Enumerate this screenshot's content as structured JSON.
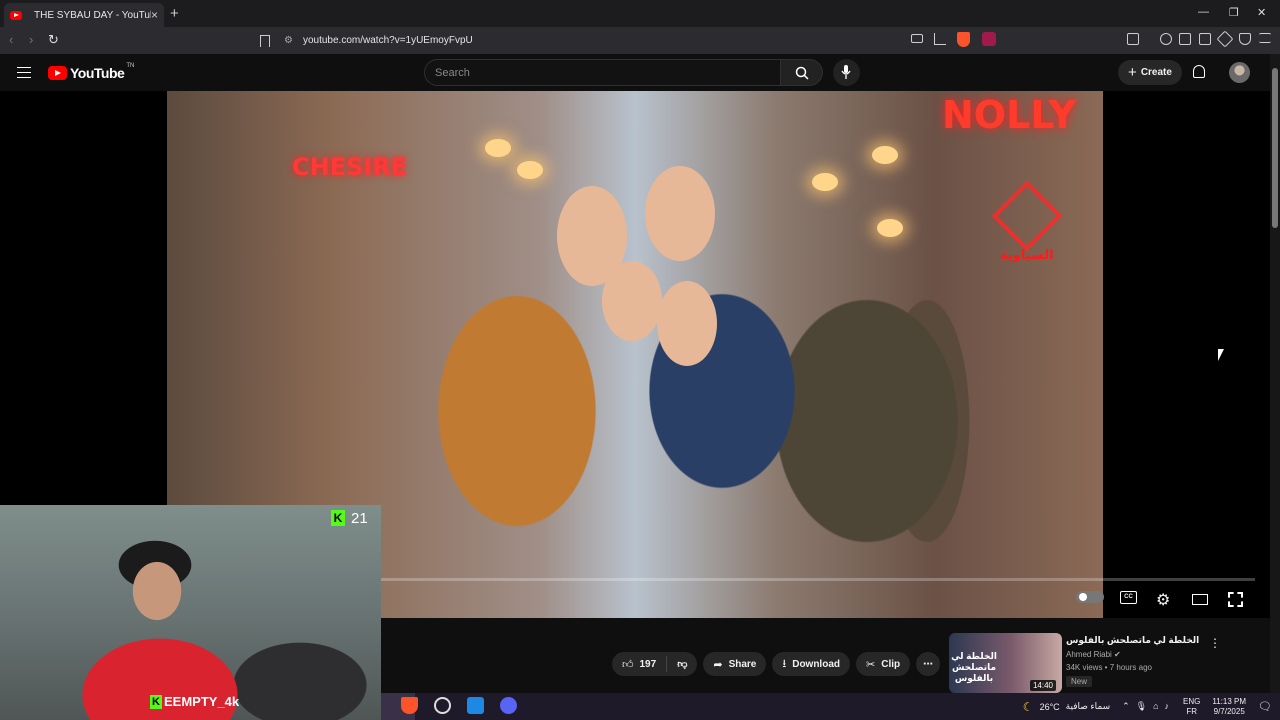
{
  "browser": {
    "tab_title": "THE SYBAU DAY - YouTube",
    "tab_close": "×",
    "new_tab": "+",
    "url": "youtube.com/watch?v=1yUEmoyFvpU",
    "win_min": "—",
    "win_restore": "❐",
    "win_close": "✕",
    "back": "‹",
    "forward": "›",
    "reload": "↻"
  },
  "youtube": {
    "logo_text": "YouTube",
    "logo_country": "TN",
    "search_placeholder": "Search",
    "create_label": "Create"
  },
  "video": {
    "watermark_text": "السياوية",
    "shop_sign_left": "CHESIRE",
    "shop_sign_right": "NOLLY"
  },
  "webcam": {
    "viewer_count": "21",
    "streamer_name": "EEMPTY_4k",
    "kick_letter": "K"
  },
  "actions": {
    "like_count": "197",
    "share_label": "Share",
    "download_label": "Download",
    "clip_label": "Clip",
    "more_label": "⋯"
  },
  "recommended": {
    "title": "الخلطة لي ماتصلحش بالفلوس",
    "thumb_text": "الخلطة لي ماتصلحش بالفلوس",
    "duration": "14:40",
    "channel": "Ahmed Riabi",
    "meta": "34K views • 7 hours ago",
    "badge": "New"
  },
  "taskbar": {
    "weather_temp": "26°C",
    "weather_cond": "سماء صافية",
    "lang_line1": "ENG",
    "lang_line2": "FR",
    "time": "11:13 PM",
    "date": "9/7/2025"
  },
  "colors": {
    "brand_red": "#ff0000",
    "kick_green": "#53fc18",
    "brave_orange": "#fb542b"
  },
  "icons": [
    "search-icon",
    "mic-icon",
    "bell-icon",
    "bookmark-icon",
    "settings-icon",
    "closed-captions-icon",
    "theater-mode-icon",
    "fullscreen-icon",
    "like-icon",
    "dislike-icon",
    "share-icon",
    "download-icon",
    "clip-icon"
  ]
}
